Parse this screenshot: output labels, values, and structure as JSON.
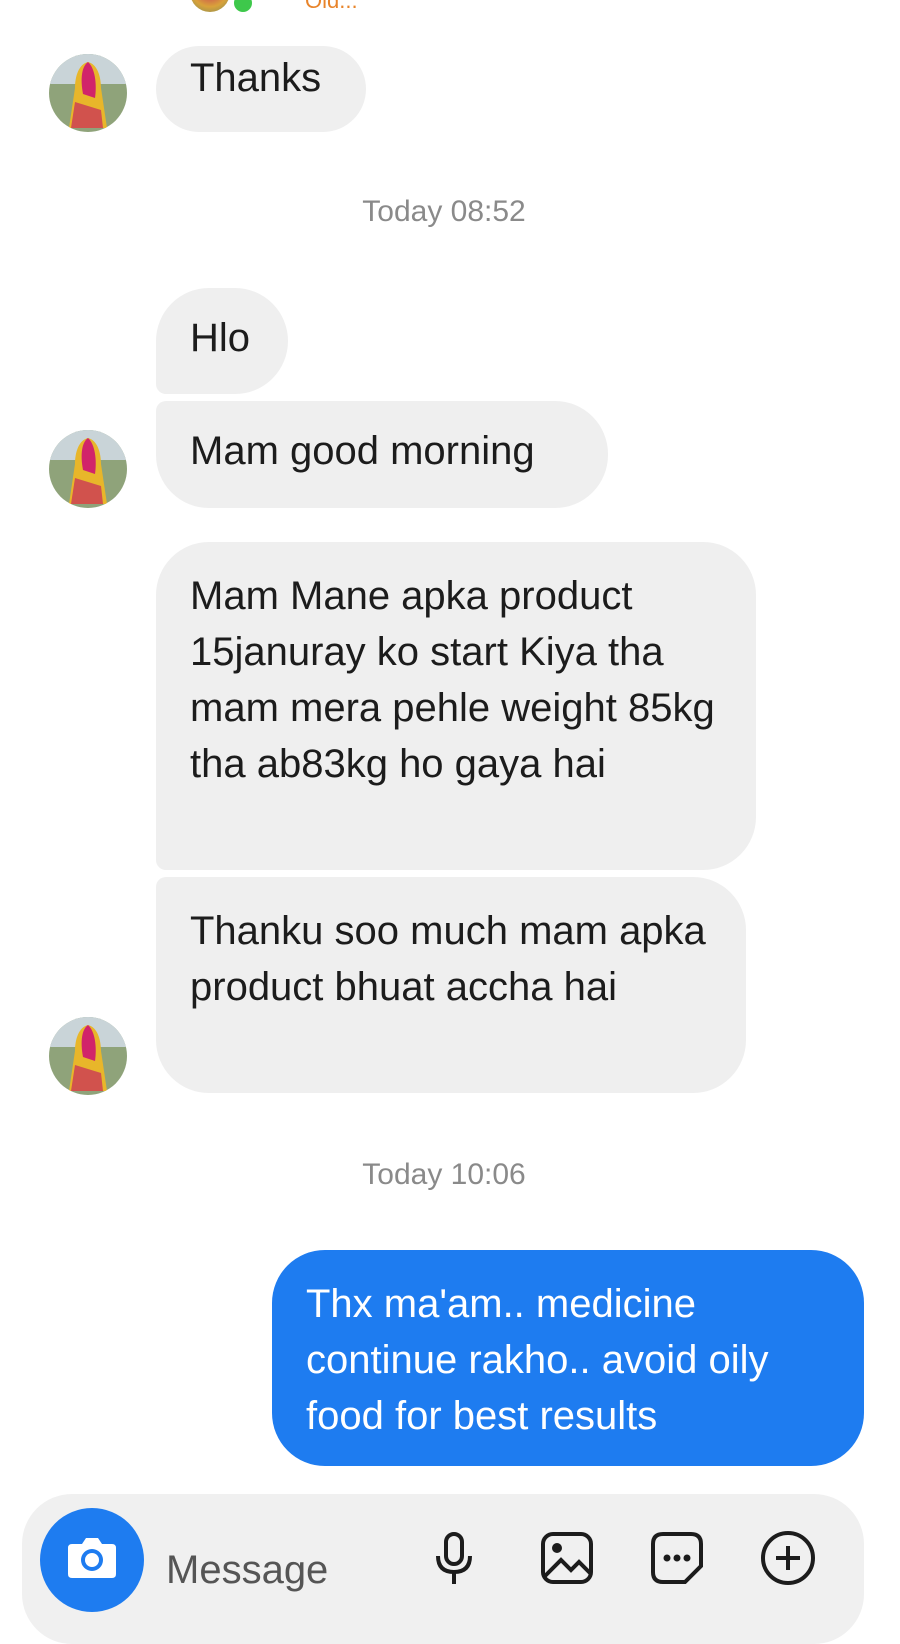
{
  "header": {
    "subtitle": "Old..."
  },
  "conversation": {
    "groups": [
      {
        "sender": "contact",
        "messages": [
          "Thanks"
        ]
      },
      {
        "timestamp": "Today 08:52"
      },
      {
        "sender": "contact",
        "messages": [
          "Hlo",
          "Mam good morning"
        ]
      },
      {
        "sender": "contact",
        "messages": [
          "Mam Mane apka product 15januray ko start Kiya tha mam mera pehle weight 85kg tha ab83kg ho gaya hai",
          "Thanku soo much mam apka product bhuat accha hai"
        ]
      },
      {
        "timestamp": "Today 10:06"
      },
      {
        "sender": "me",
        "messages": [
          "Thx ma'am.. medicine continue rakho.. avoid oily food for best results"
        ]
      }
    ]
  },
  "composer": {
    "placeholder": "Message",
    "icons": [
      "camera-icon",
      "microphone-icon",
      "image-icon",
      "sticker-icon",
      "add-icon"
    ]
  },
  "colors": {
    "outgoing_bubble": "#1e7cf0",
    "incoming_bubble": "#efefef",
    "timestamp_text": "#8a8a8a",
    "online_indicator": "#3ec84b",
    "subtitle_text": "#e8842a"
  }
}
